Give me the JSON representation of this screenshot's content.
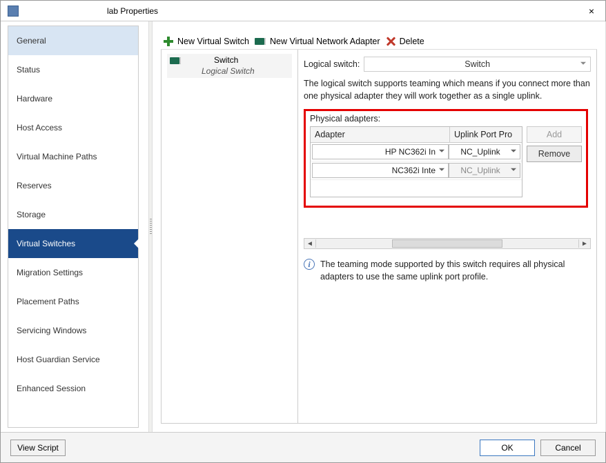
{
  "window": {
    "title": "lab Properties"
  },
  "nav": {
    "items": [
      {
        "label": "General",
        "state": "highlight"
      },
      {
        "label": "Status"
      },
      {
        "label": "Hardware"
      },
      {
        "label": "Host Access"
      },
      {
        "label": "Virtual Machine Paths"
      },
      {
        "label": "Reserves"
      },
      {
        "label": "Storage"
      },
      {
        "label": "Virtual Switches",
        "state": "selected"
      },
      {
        "label": "Migration Settings"
      },
      {
        "label": "Placement Paths"
      },
      {
        "label": "Servicing Windows"
      },
      {
        "label": "Host Guardian Service"
      },
      {
        "label": "Enhanced Session"
      }
    ]
  },
  "toolbar": {
    "new_switch": "New Virtual Switch",
    "new_adapter": "New Virtual Network Adapter",
    "delete": "Delete"
  },
  "switch_list": {
    "name": "Switch",
    "subtitle": "Logical Switch"
  },
  "detail": {
    "logical_switch_label": "Logical switch:",
    "logical_switch_value": "Switch",
    "description": "The logical switch supports teaming which means if you connect more than one physical adapter they will work together as a single uplink.",
    "physical_adapters_label": "Physical adapters:",
    "table": {
      "col_adapter": "Adapter",
      "col_uplink": "Uplink Port Pro",
      "rows": [
        {
          "adapter": "HP NC362i In",
          "uplink": "NC_Uplink",
          "uplink_disabled": false
        },
        {
          "adapter": "NC362i Inte",
          "uplink": "NC_Uplink",
          "uplink_disabled": true
        }
      ]
    },
    "add_btn": "Add",
    "remove_btn": "Remove",
    "info_text": "The teaming mode supported by this switch requires all physical adapters to use the same uplink port profile."
  },
  "footer": {
    "view_script": "View Script",
    "ok": "OK",
    "cancel": "Cancel"
  }
}
